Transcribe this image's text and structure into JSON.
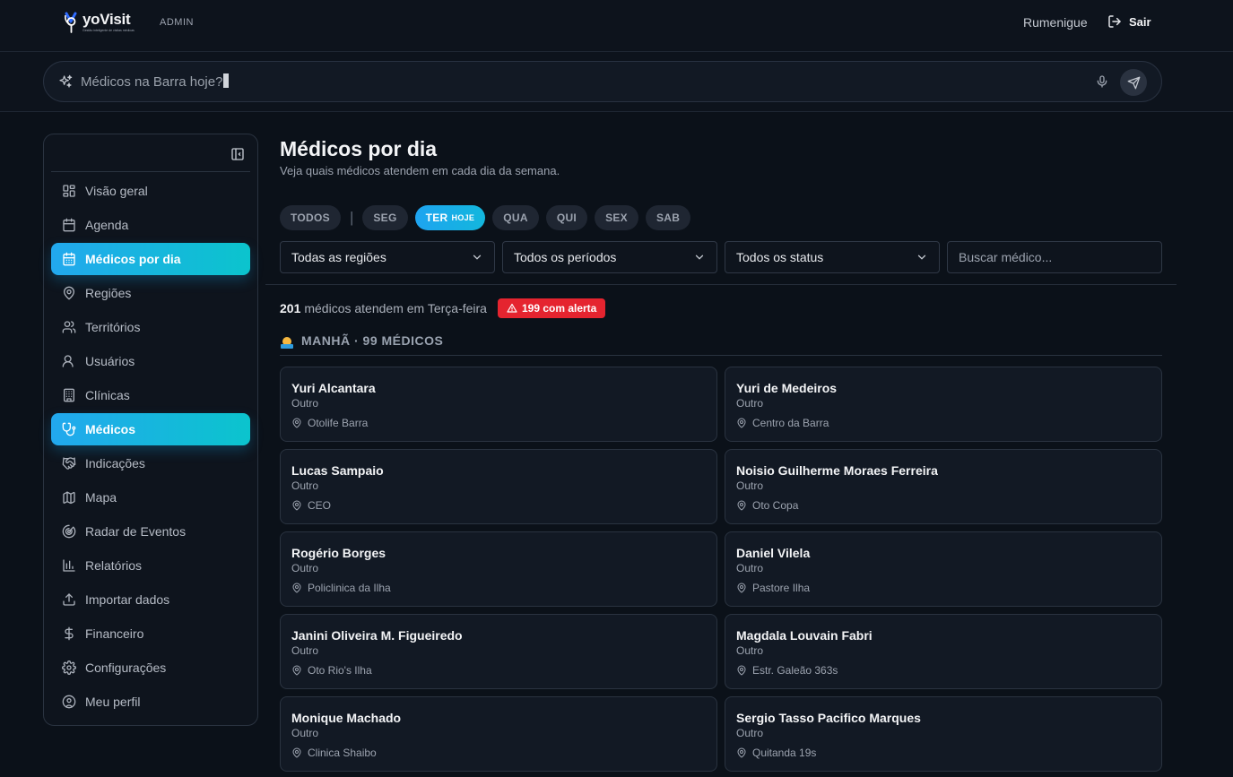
{
  "header": {
    "brand": "yoVisit",
    "tagline": "Gestão inteligente de visitas médicas",
    "role": "ADMIN",
    "user": "Rumenigue",
    "logout_label": "Sair"
  },
  "ai_search": {
    "query": "Médicos na Barra hoje?",
    "icons": [
      "sparkles-icon",
      "mic-icon",
      "send-icon"
    ]
  },
  "sidebar": {
    "items": [
      {
        "label": "Visão geral",
        "icon": "layout-grid-icon",
        "active": false
      },
      {
        "label": "Agenda",
        "icon": "calendar-icon",
        "active": false
      },
      {
        "label": "Médicos por dia",
        "icon": "calendar-days-icon",
        "active": true
      },
      {
        "label": "Regiões",
        "icon": "map-pin-icon",
        "active": false
      },
      {
        "label": "Territórios",
        "icon": "users-icon",
        "active": false
      },
      {
        "label": "Usuários",
        "icon": "user-icon",
        "active": false
      },
      {
        "label": "Clínicas",
        "icon": "building-icon",
        "active": false
      },
      {
        "label": "Médicos",
        "icon": "stethoscope-icon",
        "active": true
      },
      {
        "label": "Indicações",
        "icon": "handshake-icon",
        "active": false
      },
      {
        "label": "Mapa",
        "icon": "map-icon",
        "active": false
      },
      {
        "label": "Radar de Eventos",
        "icon": "radar-icon",
        "active": false
      },
      {
        "label": "Relatórios",
        "icon": "bar-chart-icon",
        "active": false
      },
      {
        "label": "Importar dados",
        "icon": "upload-icon",
        "active": false
      },
      {
        "label": "Financeiro",
        "icon": "dollar-icon",
        "active": false
      },
      {
        "label": "Configurações",
        "icon": "gear-icon",
        "active": false
      },
      {
        "label": "Meu perfil",
        "icon": "user-circle-icon",
        "active": false
      }
    ]
  },
  "main": {
    "title": "Médicos por dia",
    "subtitle": "Veja quais médicos atendem em cada dia da semana.",
    "days": {
      "all": "TODOS",
      "separator": "|",
      "list": [
        {
          "label": "SEG",
          "active": false
        },
        {
          "label": "TER",
          "today": "HOJE",
          "active": true
        },
        {
          "label": "QUA",
          "active": false
        },
        {
          "label": "QUI",
          "active": false
        },
        {
          "label": "SEX",
          "active": false
        },
        {
          "label": "SAB",
          "active": false
        }
      ]
    },
    "filters": {
      "region": "Todas as regiões",
      "period": "Todos os períodos",
      "status": "Todos os status",
      "search_placeholder": "Buscar médico..."
    },
    "summary": {
      "count": "201",
      "text": "médicos atendem em Terça-feira",
      "alert": "199 com alerta"
    },
    "period_header": "MANHÃ · 99 MÉDICOS",
    "doctors": [
      {
        "name": "Yuri Alcantara",
        "specialty": "Outro",
        "location": "Otolife Barra"
      },
      {
        "name": "Yuri de Medeiros",
        "specialty": "Outro",
        "location": "Centro da Barra"
      },
      {
        "name": "Lucas Sampaio",
        "specialty": "Outro",
        "location": "CEO"
      },
      {
        "name": "Noisio Guilherme Moraes Ferreira",
        "specialty": "Outro",
        "location": "Oto Copa"
      },
      {
        "name": "Rogério Borges",
        "specialty": "Outro",
        "location": "Policlinica da Ilha"
      },
      {
        "name": "Daniel Vilela",
        "specialty": "Outro",
        "location": "Pastore Ilha"
      },
      {
        "name": "Janini Oliveira M. Figueiredo",
        "specialty": "Outro",
        "location": "Oto Rio's Ilha"
      },
      {
        "name": "Magdala Louvain Fabri",
        "specialty": "Outro",
        "location": "Estr. Galeão 363s"
      },
      {
        "name": "Monique Machado",
        "specialty": "Outro",
        "location": "Clinica Shaibo"
      },
      {
        "name": "Sergio Tasso Pacifico Marques",
        "specialty": "Outro",
        "location": "Quitanda 19s"
      }
    ]
  },
  "colors": {
    "background": "#0b1119",
    "accent_gradient_start": "#22a8ee",
    "accent_gradient_end": "#0bc4cd",
    "alert": "#e5242f"
  }
}
